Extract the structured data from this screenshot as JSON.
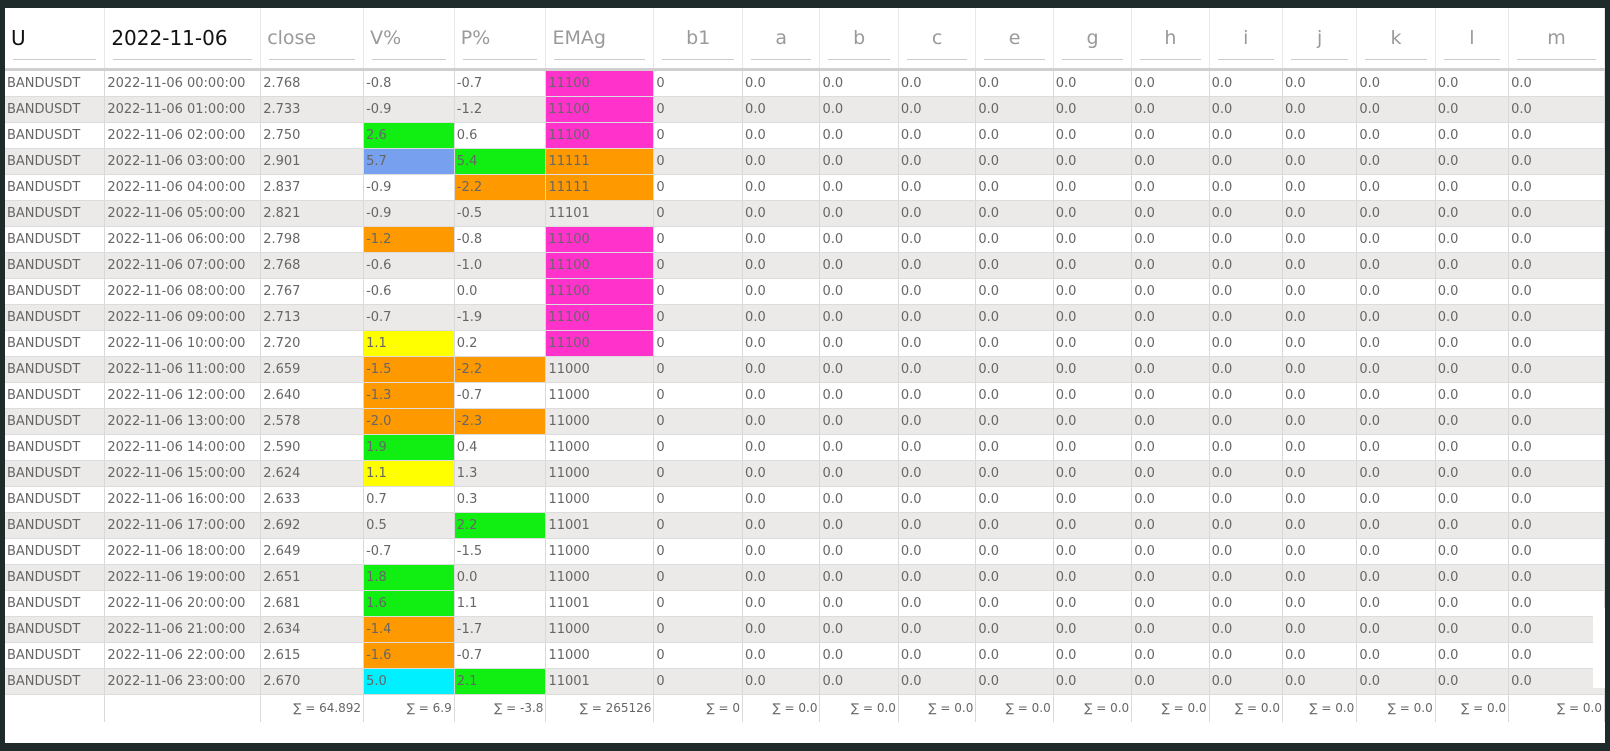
{
  "colors": {
    "magenta": "#ff33cc",
    "green": "#11ee11",
    "blue": "#77a0ee",
    "orange": "#ff9900",
    "yellow": "#ffff00",
    "cyan": "#00f0ff"
  },
  "header": {
    "cols": [
      "U",
      "2022-11-06",
      "close",
      "V%",
      "P%",
      "EMAg",
      "b1",
      "a",
      "b",
      "c",
      "e",
      "g",
      "h",
      "i",
      "j",
      "k",
      "l",
      "m"
    ]
  },
  "rows": [
    {
      "symbol": "BANDUSDT",
      "time": "2022-11-06 00:00:00",
      "close": "2.768",
      "v": "-0.8",
      "p": "-0.7",
      "emag": "11100",
      "b1": "0",
      "vals": [
        "0.0",
        "0.0",
        "0.0",
        "0.0",
        "0.0",
        "0.0",
        "0.0",
        "0.0",
        "0.0",
        "0.0",
        "0.0"
      ],
      "vcolor": "",
      "pcolor": "",
      "ecolor": "magenta"
    },
    {
      "symbol": "BANDUSDT",
      "time": "2022-11-06 01:00:00",
      "close": "2.733",
      "v": "-0.9",
      "p": "-1.2",
      "emag": "11100",
      "b1": "0",
      "vals": [
        "0.0",
        "0.0",
        "0.0",
        "0.0",
        "0.0",
        "0.0",
        "0.0",
        "0.0",
        "0.0",
        "0.0",
        "0.0"
      ],
      "vcolor": "",
      "pcolor": "",
      "ecolor": "magenta"
    },
    {
      "symbol": "BANDUSDT",
      "time": "2022-11-06 02:00:00",
      "close": "2.750",
      "v": "2.6",
      "p": "0.6",
      "emag": "11100",
      "b1": "0",
      "vals": [
        "0.0",
        "0.0",
        "0.0",
        "0.0",
        "0.0",
        "0.0",
        "0.0",
        "0.0",
        "0.0",
        "0.0",
        "0.0"
      ],
      "vcolor": "green",
      "pcolor": "",
      "ecolor": "magenta"
    },
    {
      "symbol": "BANDUSDT",
      "time": "2022-11-06 03:00:00",
      "close": "2.901",
      "v": "5.7",
      "p": "5.4",
      "emag": "11111",
      "b1": "0",
      "vals": [
        "0.0",
        "0.0",
        "0.0",
        "0.0",
        "0.0",
        "0.0",
        "0.0",
        "0.0",
        "0.0",
        "0.0",
        "0.0"
      ],
      "vcolor": "blue",
      "pcolor": "green",
      "ecolor": "orange"
    },
    {
      "symbol": "BANDUSDT",
      "time": "2022-11-06 04:00:00",
      "close": "2.837",
      "v": "-0.9",
      "p": "-2.2",
      "emag": "11111",
      "b1": "0",
      "vals": [
        "0.0",
        "0.0",
        "0.0",
        "0.0",
        "0.0",
        "0.0",
        "0.0",
        "0.0",
        "0.0",
        "0.0",
        "0.0"
      ],
      "vcolor": "",
      "pcolor": "orange",
      "ecolor": "orange"
    },
    {
      "symbol": "BANDUSDT",
      "time": "2022-11-06 05:00:00",
      "close": "2.821",
      "v": "-0.9",
      "p": "-0.5",
      "emag": "11101",
      "b1": "0",
      "vals": [
        "0.0",
        "0.0",
        "0.0",
        "0.0",
        "0.0",
        "0.0",
        "0.0",
        "0.0",
        "0.0",
        "0.0",
        "0.0"
      ],
      "vcolor": "",
      "pcolor": "",
      "ecolor": ""
    },
    {
      "symbol": "BANDUSDT",
      "time": "2022-11-06 06:00:00",
      "close": "2.798",
      "v": "-1.2",
      "p": "-0.8",
      "emag": "11100",
      "b1": "0",
      "vals": [
        "0.0",
        "0.0",
        "0.0",
        "0.0",
        "0.0",
        "0.0",
        "0.0",
        "0.0",
        "0.0",
        "0.0",
        "0.0"
      ],
      "vcolor": "orange",
      "pcolor": "",
      "ecolor": "magenta"
    },
    {
      "symbol": "BANDUSDT",
      "time": "2022-11-06 07:00:00",
      "close": "2.768",
      "v": "-0.6",
      "p": "-1.0",
      "emag": "11100",
      "b1": "0",
      "vals": [
        "0.0",
        "0.0",
        "0.0",
        "0.0",
        "0.0",
        "0.0",
        "0.0",
        "0.0",
        "0.0",
        "0.0",
        "0.0"
      ],
      "vcolor": "",
      "pcolor": "",
      "ecolor": "magenta"
    },
    {
      "symbol": "BANDUSDT",
      "time": "2022-11-06 08:00:00",
      "close": "2.767",
      "v": "-0.6",
      "p": "0.0",
      "emag": "11100",
      "b1": "0",
      "vals": [
        "0.0",
        "0.0",
        "0.0",
        "0.0",
        "0.0",
        "0.0",
        "0.0",
        "0.0",
        "0.0",
        "0.0",
        "0.0"
      ],
      "vcolor": "",
      "pcolor": "",
      "ecolor": "magenta"
    },
    {
      "symbol": "BANDUSDT",
      "time": "2022-11-06 09:00:00",
      "close": "2.713",
      "v": "-0.7",
      "p": "-1.9",
      "emag": "11100",
      "b1": "0",
      "vals": [
        "0.0",
        "0.0",
        "0.0",
        "0.0",
        "0.0",
        "0.0",
        "0.0",
        "0.0",
        "0.0",
        "0.0",
        "0.0"
      ],
      "vcolor": "",
      "pcolor": "",
      "ecolor": "magenta"
    },
    {
      "symbol": "BANDUSDT",
      "time": "2022-11-06 10:00:00",
      "close": "2.720",
      "v": "1.1",
      "p": "0.2",
      "emag": "11100",
      "b1": "0",
      "vals": [
        "0.0",
        "0.0",
        "0.0",
        "0.0",
        "0.0",
        "0.0",
        "0.0",
        "0.0",
        "0.0",
        "0.0",
        "0.0"
      ],
      "vcolor": "yellow",
      "pcolor": "",
      "ecolor": "magenta"
    },
    {
      "symbol": "BANDUSDT",
      "time": "2022-11-06 11:00:00",
      "close": "2.659",
      "v": "-1.5",
      "p": "-2.2",
      "emag": "11000",
      "b1": "0",
      "vals": [
        "0.0",
        "0.0",
        "0.0",
        "0.0",
        "0.0",
        "0.0",
        "0.0",
        "0.0",
        "0.0",
        "0.0",
        "0.0"
      ],
      "vcolor": "orange",
      "pcolor": "orange",
      "ecolor": ""
    },
    {
      "symbol": "BANDUSDT",
      "time": "2022-11-06 12:00:00",
      "close": "2.640",
      "v": "-1.3",
      "p": "-0.7",
      "emag": "11000",
      "b1": "0",
      "vals": [
        "0.0",
        "0.0",
        "0.0",
        "0.0",
        "0.0",
        "0.0",
        "0.0",
        "0.0",
        "0.0",
        "0.0",
        "0.0"
      ],
      "vcolor": "orange",
      "pcolor": "",
      "ecolor": ""
    },
    {
      "symbol": "BANDUSDT",
      "time": "2022-11-06 13:00:00",
      "close": "2.578",
      "v": "-2.0",
      "p": "-2.3",
      "emag": "11000",
      "b1": "0",
      "vals": [
        "0.0",
        "0.0",
        "0.0",
        "0.0",
        "0.0",
        "0.0",
        "0.0",
        "0.0",
        "0.0",
        "0.0",
        "0.0"
      ],
      "vcolor": "orange",
      "pcolor": "orange",
      "ecolor": ""
    },
    {
      "symbol": "BANDUSDT",
      "time": "2022-11-06 14:00:00",
      "close": "2.590",
      "v": "1.9",
      "p": "0.4",
      "emag": "11000",
      "b1": "0",
      "vals": [
        "0.0",
        "0.0",
        "0.0",
        "0.0",
        "0.0",
        "0.0",
        "0.0",
        "0.0",
        "0.0",
        "0.0",
        "0.0"
      ],
      "vcolor": "green",
      "pcolor": "",
      "ecolor": ""
    },
    {
      "symbol": "BANDUSDT",
      "time": "2022-11-06 15:00:00",
      "close": "2.624",
      "v": "1.1",
      "p": "1.3",
      "emag": "11000",
      "b1": "0",
      "vals": [
        "0.0",
        "0.0",
        "0.0",
        "0.0",
        "0.0",
        "0.0",
        "0.0",
        "0.0",
        "0.0",
        "0.0",
        "0.0"
      ],
      "vcolor": "yellow",
      "pcolor": "",
      "ecolor": ""
    },
    {
      "symbol": "BANDUSDT",
      "time": "2022-11-06 16:00:00",
      "close": "2.633",
      "v": "0.7",
      "p": "0.3",
      "emag": "11000",
      "b1": "0",
      "vals": [
        "0.0",
        "0.0",
        "0.0",
        "0.0",
        "0.0",
        "0.0",
        "0.0",
        "0.0",
        "0.0",
        "0.0",
        "0.0"
      ],
      "vcolor": "",
      "pcolor": "",
      "ecolor": ""
    },
    {
      "symbol": "BANDUSDT",
      "time": "2022-11-06 17:00:00",
      "close": "2.692",
      "v": "0.5",
      "p": "2.2",
      "emag": "11001",
      "b1": "0",
      "vals": [
        "0.0",
        "0.0",
        "0.0",
        "0.0",
        "0.0",
        "0.0",
        "0.0",
        "0.0",
        "0.0",
        "0.0",
        "0.0"
      ],
      "vcolor": "",
      "pcolor": "green",
      "ecolor": ""
    },
    {
      "symbol": "BANDUSDT",
      "time": "2022-11-06 18:00:00",
      "close": "2.649",
      "v": "-0.7",
      "p": "-1.5",
      "emag": "11000",
      "b1": "0",
      "vals": [
        "0.0",
        "0.0",
        "0.0",
        "0.0",
        "0.0",
        "0.0",
        "0.0",
        "0.0",
        "0.0",
        "0.0",
        "0.0"
      ],
      "vcolor": "",
      "pcolor": "",
      "ecolor": ""
    },
    {
      "symbol": "BANDUSDT",
      "time": "2022-11-06 19:00:00",
      "close": "2.651",
      "v": "1.8",
      "p": "0.0",
      "emag": "11000",
      "b1": "0",
      "vals": [
        "0.0",
        "0.0",
        "0.0",
        "0.0",
        "0.0",
        "0.0",
        "0.0",
        "0.0",
        "0.0",
        "0.0",
        "0.0"
      ],
      "vcolor": "green",
      "pcolor": "",
      "ecolor": ""
    },
    {
      "symbol": "BANDUSDT",
      "time": "2022-11-06 20:00:00",
      "close": "2.681",
      "v": "1.6",
      "p": "1.1",
      "emag": "11001",
      "b1": "0",
      "vals": [
        "0.0",
        "0.0",
        "0.0",
        "0.0",
        "0.0",
        "0.0",
        "0.0",
        "0.0",
        "0.0",
        "0.0",
        "0.0"
      ],
      "vcolor": "green",
      "pcolor": "",
      "ecolor": ""
    },
    {
      "symbol": "BANDUSDT",
      "time": "2022-11-06 21:00:00",
      "close": "2.634",
      "v": "-1.4",
      "p": "-1.7",
      "emag": "11000",
      "b1": "0",
      "vals": [
        "0.0",
        "0.0",
        "0.0",
        "0.0",
        "0.0",
        "0.0",
        "0.0",
        "0.0",
        "0.0",
        "0.0",
        "0.0"
      ],
      "vcolor": "orange",
      "pcolor": "",
      "ecolor": ""
    },
    {
      "symbol": "BANDUSDT",
      "time": "2022-11-06 22:00:00",
      "close": "2.615",
      "v": "-1.6",
      "p": "-0.7",
      "emag": "11000",
      "b1": "0",
      "vals": [
        "0.0",
        "0.0",
        "0.0",
        "0.0",
        "0.0",
        "0.0",
        "0.0",
        "0.0",
        "0.0",
        "0.0",
        "0.0"
      ],
      "vcolor": "orange",
      "pcolor": "",
      "ecolor": ""
    },
    {
      "symbol": "BANDUSDT",
      "time": "2022-11-06 23:00:00",
      "close": "2.670",
      "v": "5.0",
      "p": "2.1",
      "emag": "11001",
      "b1": "0",
      "vals": [
        "0.0",
        "0.0",
        "0.0",
        "0.0",
        "0.0",
        "0.0",
        "0.0",
        "0.0",
        "0.0",
        "0.0",
        "0.0"
      ],
      "vcolor": "cyan",
      "pcolor": "green",
      "ecolor": ""
    }
  ],
  "totals": [
    "",
    "",
    "∑ = 64.892",
    "∑ = 6.9",
    "∑ = -3.8",
    "∑ = 265126",
    "∑ = 0",
    "∑ = 0.0",
    "∑ = 0.0",
    "∑ = 0.0",
    "∑ = 0.0",
    "∑ = 0.0",
    "∑ = 0.0",
    "∑ = 0.0",
    "∑ = 0.0",
    "∑ = 0.0",
    "∑ = 0.0",
    "∑ = 0.0"
  ]
}
